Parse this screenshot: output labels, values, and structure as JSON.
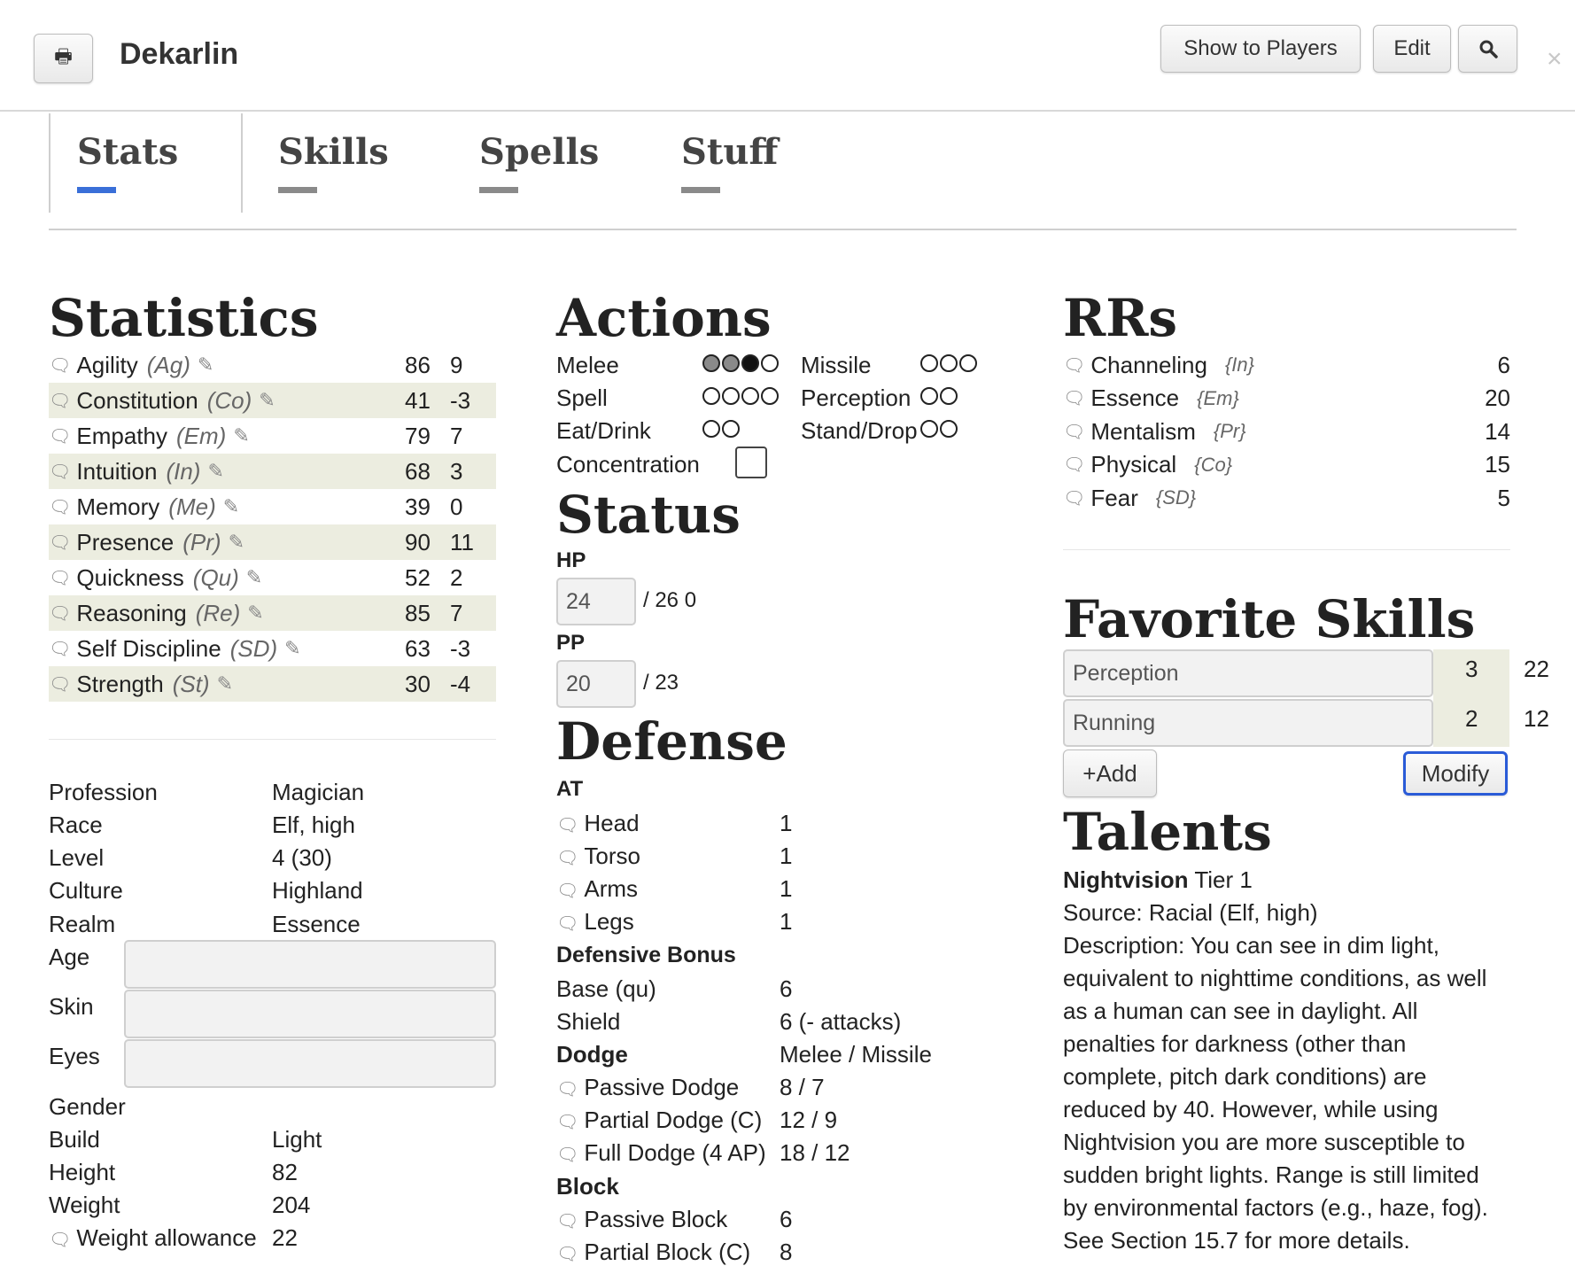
{
  "header": {
    "title": "Dekarlin",
    "show_label": "Show to Players",
    "edit_label": "Edit",
    "print_icon": "print-icon",
    "search_icon": "search-icon",
    "close_glyph": "×"
  },
  "tabs": [
    {
      "label": "Stats",
      "active": true
    },
    {
      "label": "Skills"
    },
    {
      "label": "Spells"
    },
    {
      "label": "Stuff"
    }
  ],
  "statistics": {
    "heading": "Statistics",
    "rows": [
      {
        "name": "Agility",
        "abbr": "(Ag)",
        "value": "86",
        "bonus": "9"
      },
      {
        "name": "Constitution",
        "abbr": "(Co)",
        "value": "41",
        "bonus": "-3"
      },
      {
        "name": "Empathy",
        "abbr": "(Em)",
        "value": "79",
        "bonus": "7"
      },
      {
        "name": "Intuition",
        "abbr": "(In)",
        "value": "68",
        "bonus": "3"
      },
      {
        "name": "Memory",
        "abbr": "(Me)",
        "value": "39",
        "bonus": "0"
      },
      {
        "name": "Presence",
        "abbr": "(Pr)",
        "value": "90",
        "bonus": "11"
      },
      {
        "name": "Quickness",
        "abbr": "(Qu)",
        "value": "52",
        "bonus": "2"
      },
      {
        "name": "Reasoning",
        "abbr": "(Re)",
        "value": "85",
        "bonus": "7"
      },
      {
        "name": "Self Discipline",
        "abbr": "(SD)",
        "value": "63",
        "bonus": "-3"
      },
      {
        "name": "Strength",
        "abbr": "(St)",
        "value": "30",
        "bonus": "-4"
      }
    ]
  },
  "bio": {
    "profession": {
      "label": "Profession",
      "value": "Magician"
    },
    "race": {
      "label": "Race",
      "value": "Elf, high"
    },
    "level": {
      "label": "Level",
      "value": "4 (30)"
    },
    "culture": {
      "label": "Culture",
      "value": "Highland"
    },
    "realm": {
      "label": "Realm",
      "value": "Essence"
    },
    "age": {
      "label": "Age",
      "value": ""
    },
    "skin": {
      "label": "Skin",
      "value": ""
    },
    "eyes": {
      "label": "Eyes",
      "value": ""
    },
    "gender": {
      "label": "Gender",
      "value": ""
    },
    "build": {
      "label": "Build",
      "value": "Light"
    },
    "height": {
      "label": "Height",
      "value": "82"
    },
    "weight": {
      "label": "Weight",
      "value": "204"
    },
    "weight_allowance": {
      "label": "Weight allowance",
      "value": "22"
    }
  },
  "actions": {
    "heading": "Actions",
    "melee": "Melee",
    "missile": "Missile",
    "spell": "Spell",
    "perception": "Perception",
    "eat": "Eat/Drink",
    "stand": "Stand/Drop",
    "concentration": "Concentration",
    "melee_used": 2,
    "melee_active": 1,
    "melee_total": 4
  },
  "status": {
    "heading": "Status",
    "hp_label": "HP",
    "hp_value": "24",
    "hp_max": "/ 26 0",
    "pp_label": "PP",
    "pp_value": "20",
    "pp_max": "/ 23"
  },
  "defense": {
    "heading": "Defense",
    "at_label": "AT",
    "at": [
      {
        "label": "Head",
        "value": "1"
      },
      {
        "label": "Torso",
        "value": "1"
      },
      {
        "label": "Arms",
        "value": "1"
      },
      {
        "label": "Legs",
        "value": "1"
      }
    ],
    "db_label": "Defensive Bonus",
    "base": {
      "label": "Base (qu)",
      "value": "6"
    },
    "shield": {
      "label": "Shield",
      "value": "6 (- attacks)"
    },
    "dodge": {
      "label": "Dodge",
      "value": "Melee / Missile"
    },
    "dodges": [
      {
        "label": "Passive Dodge",
        "value": "8 / 7"
      },
      {
        "label": "Partial Dodge (C)",
        "value": "12 / 9"
      },
      {
        "label": "Full Dodge (4 AP)",
        "value": "18 / 12"
      }
    ],
    "block_label": "Block",
    "blocks": [
      {
        "label": "Passive Block",
        "value": "6"
      },
      {
        "label": "Partial Block (C)",
        "value": "8"
      }
    ]
  },
  "rrs": {
    "heading": "RRs",
    "rows": [
      {
        "name": "Channeling",
        "abbr": "{In}",
        "value": "6"
      },
      {
        "name": "Essence",
        "abbr": "{Em}",
        "value": "20"
      },
      {
        "name": "Mentalism",
        "abbr": "{Pr}",
        "value": "14"
      },
      {
        "name": "Physical",
        "abbr": "{Co}",
        "value": "15"
      },
      {
        "name": "Fear",
        "abbr": "{SD}",
        "value": "5"
      }
    ]
  },
  "favorites": {
    "heading": "Favorite Skills",
    "rows": [
      {
        "name": "Perception",
        "ranks": "3",
        "bonus": "22"
      },
      {
        "name": "Running",
        "ranks": "2",
        "bonus": "12"
      }
    ],
    "add_label": "+Add",
    "modify_label": "Modify"
  },
  "talents": {
    "heading": "Talents",
    "name": "Nightvision",
    "tier": "Tier 1",
    "source": "Source: Racial (Elf, high)",
    "desc_lines": [
      "Description: You can see in dim light,",
      "equivalent to nighttime conditions, as well",
      "as a human can see in daylight. All",
      "penalties for darkness (other than",
      "complete, pitch dark conditions) are",
      "reduced by 40. However, while using",
      "Nightvision you are more susceptible to",
      "sudden bright lights. Range is still limited",
      "by environmental factors (e.g., haze, fog).",
      "See Section 15.7 for more details."
    ]
  },
  "colors": {
    "accent": "#3a6fd8",
    "row_shade": "#ecede0"
  }
}
